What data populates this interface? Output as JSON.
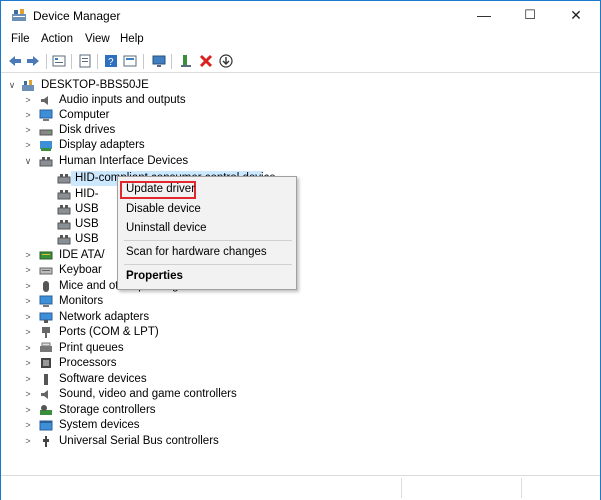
{
  "window": {
    "title": "Device Manager",
    "controls": {
      "minimize": "—",
      "maximize": "☐",
      "close": "✕"
    }
  },
  "menu": [
    "File",
    "Action",
    "View",
    "Help"
  ],
  "toolbar_icons": [
    "back-arrow-icon",
    "forward-arrow-icon",
    "properties-grid-icon",
    "document-icon",
    "help-icon",
    "view-icon",
    "monitor-icon",
    "enable-device-icon",
    "uninstall-x-icon",
    "update-down-arrow-icon"
  ],
  "tree": {
    "root": "DESKTOP-BBS50JE",
    "categories": [
      "Audio inputs and outputs",
      "Computer",
      "Disk drives",
      "Display adapters",
      "Human Interface Devices"
    ],
    "hid_children": [
      "HID-compliant consumer control device",
      "HID-",
      "USB",
      "USB",
      "USB"
    ],
    "more_categories": [
      "IDE ATA/",
      "Keyboar",
      "Mice and other pointing devices",
      "Monitors",
      "Network adapters",
      "Ports (COM & LPT)",
      "Print queues",
      "Processors",
      "Software devices",
      "Sound, video and game controllers",
      "Storage controllers",
      "System devices",
      "Universal Serial Bus controllers"
    ]
  },
  "context_menu": {
    "update_driver": "Update driver",
    "disable_device": "Disable device",
    "uninstall_device": "Uninstall device",
    "scan": "Scan for hardware changes",
    "properties": "Properties"
  },
  "colors": {
    "selection": "#cce8ff",
    "highlight_box": "#e0282e",
    "uninstall_red": "#d9221f",
    "window_border": "#1979ca"
  }
}
